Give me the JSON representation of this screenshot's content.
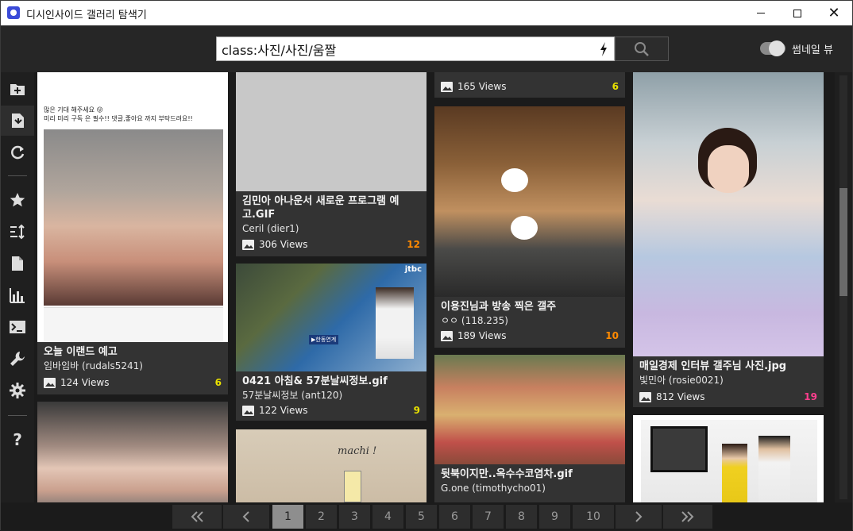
{
  "window": {
    "title": "디시인사이드 갤러리 탐색기"
  },
  "search": {
    "value": "class:사진/사진/움짤",
    "bolt_icon": "bolt-icon",
    "button_icon": "search-icon"
  },
  "thumbnail_toggle": {
    "label": "썸네일 뷰",
    "on": true
  },
  "sidebar": {
    "items": [
      {
        "icon": "add-folder-icon"
      },
      {
        "icon": "import-icon"
      },
      {
        "icon": "refresh-icon"
      },
      {
        "icon": "star-icon"
      },
      {
        "icon": "sort-icon"
      },
      {
        "icon": "document-icon"
      },
      {
        "icon": "chart-icon"
      },
      {
        "icon": "terminal-icon"
      },
      {
        "icon": "wrench-icon"
      },
      {
        "icon": "gear-icon"
      },
      {
        "icon": "help-icon"
      }
    ]
  },
  "cards": [
    {
      "title": "오늘 이랜드 예고",
      "author": "임바임바 (rudals5241)",
      "views": "124 Views",
      "count": "6",
      "count_color": "#e8e000"
    },
    {
      "title": "",
      "author": "",
      "views": "",
      "count": ""
    },
    {
      "title": "김민아 아나운서 새로운 프로그램 예고.GIF",
      "author": "Ceril (dier1)",
      "views": "306 Views",
      "count": "12",
      "count_color": "#ff8a00"
    },
    {
      "title": "0421 아침& 57분날씨정보.gif",
      "author": "57분날씨정보 (ant120)",
      "views": "122 Views",
      "count": "9",
      "count_color": "#e8e000"
    },
    {
      "title": "",
      "author": "",
      "views": "165 Views",
      "count": "6",
      "count_color": "#e8e000"
    },
    {
      "title": "이용진님과 방송 찍은 갤주",
      "author": "ㅇㅇ (118.235)",
      "views": "189 Views",
      "count": "10",
      "count_color": "#ff8a00"
    },
    {
      "title": "뒷북이지만..옥수수코염차.gif",
      "author": "G.one (timothycho01)",
      "views": "",
      "count": ""
    },
    {
      "title": "매일경제 인터뷰 갤주님 사진.jpg",
      "author": "빛민아 (rosie0021)",
      "views": "812 Views",
      "count": "19",
      "count_color": "#ff3f8e"
    },
    {
      "title": "",
      "author": "",
      "views": "",
      "count": ""
    }
  ],
  "overlays": {
    "card1_caption_line1": "많은 기대 해주세요 😛",
    "card1_caption_line2": "미리 미리 구독 은 필수!! 댓글,좋아요 까지 부탁드려요!!",
    "jtbc": "jtbc",
    "weather_badge": "▶한동연계",
    "machi": "machi !"
  },
  "pagination": {
    "first_icon": "double-chevron-left-icon",
    "prev_icon": "chevron-left-icon",
    "pages": [
      "1",
      "2",
      "3",
      "4",
      "5",
      "6",
      "7",
      "8",
      "9",
      "10"
    ],
    "current": "1",
    "next_icon": "chevron-right-icon",
    "last_icon": "double-chevron-right-icon"
  }
}
